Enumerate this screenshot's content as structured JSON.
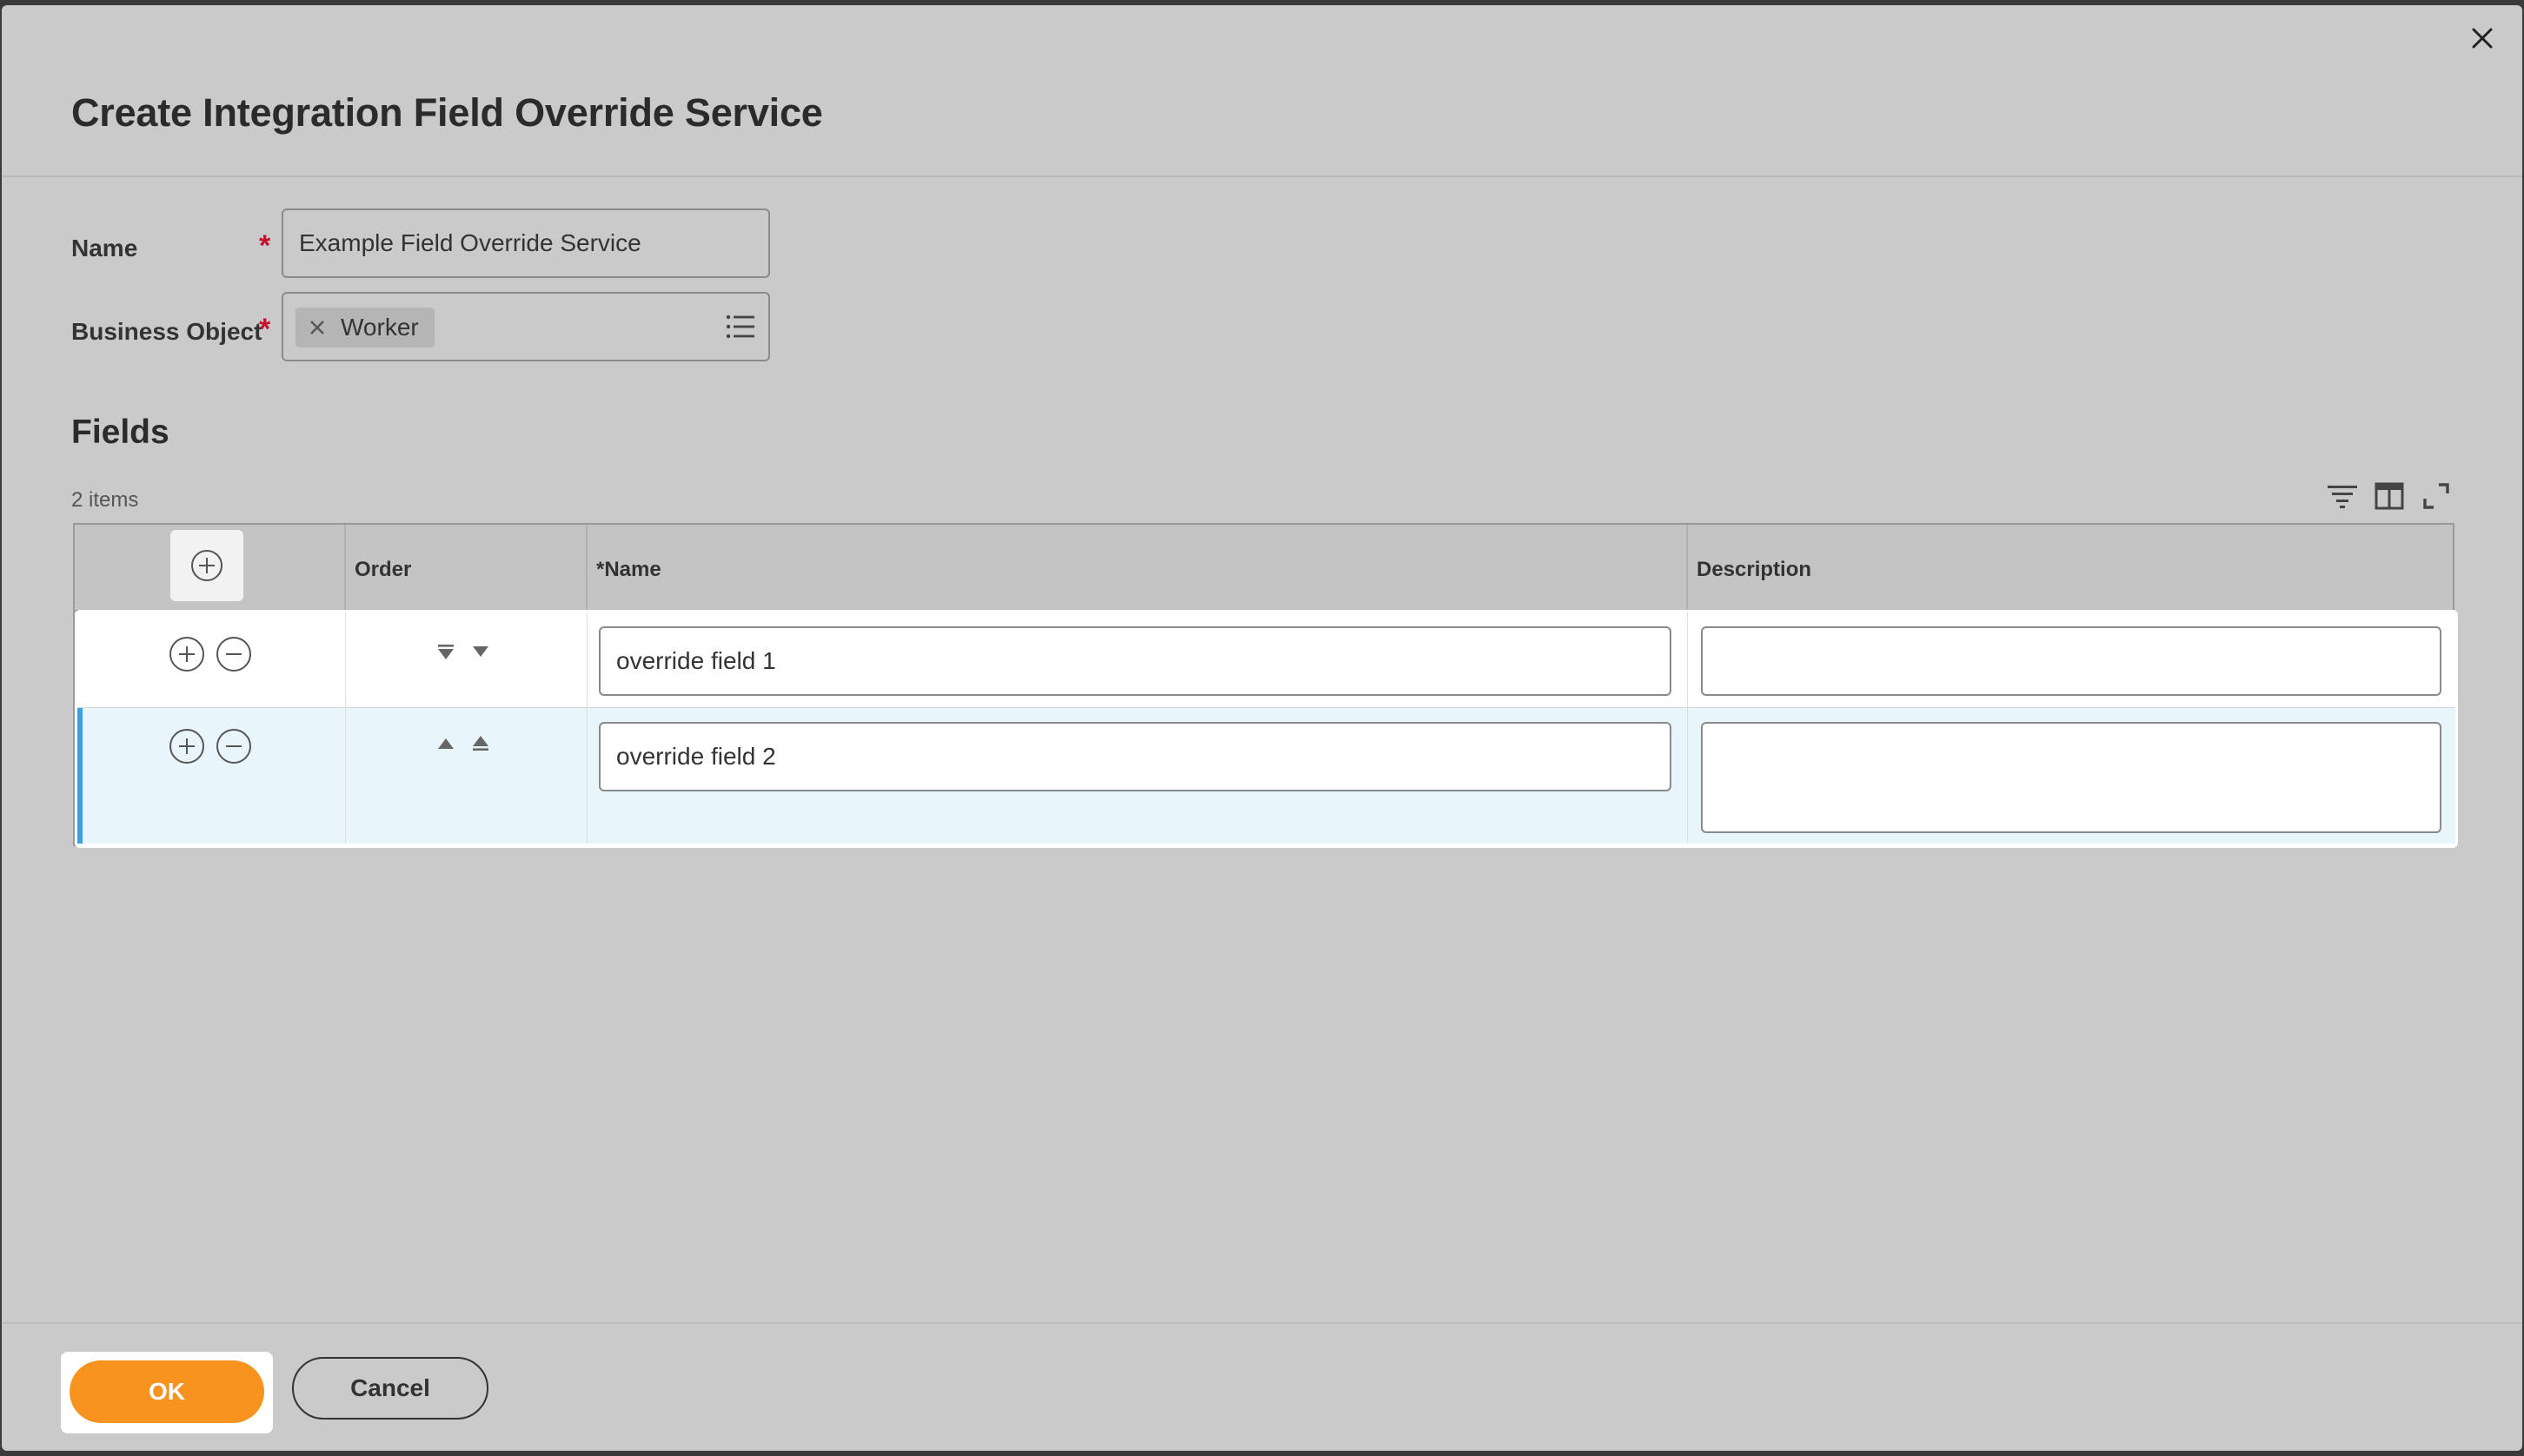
{
  "dialog": {
    "title": "Create Integration Field Override Service",
    "close_icon": "close-icon"
  },
  "form": {
    "name_label": "Name",
    "name_value": "Example Field Override Service",
    "business_object_label": "Business Object",
    "required_marker": "*",
    "business_object_chip": "Worker",
    "chip_remove_icon": "x-icon",
    "prompt_icon": "list-icon"
  },
  "fields": {
    "title": "Fields",
    "items_count": "2 items",
    "toolbar_icons": [
      "filter-icon",
      "column-layout-icon",
      "expand-icon"
    ],
    "columns": [
      "Order",
      "*Name",
      "Description"
    ],
    "rows": [
      {
        "name": "override field 1",
        "description": "",
        "order_icons": [
          "move-to-bottom-icon",
          "move-down-icon"
        ]
      },
      {
        "name": "override field 2",
        "description": "",
        "order_icons": [
          "move-up-icon",
          "move-to-top-icon"
        ]
      }
    ]
  },
  "footer": {
    "ok_label": "OK",
    "cancel_label": "Cancel"
  },
  "colors": {
    "accent": "#f7931e",
    "required": "#c8102e",
    "selected_row": "#e8f6fb",
    "selected_bar": "#3aa0e0"
  }
}
